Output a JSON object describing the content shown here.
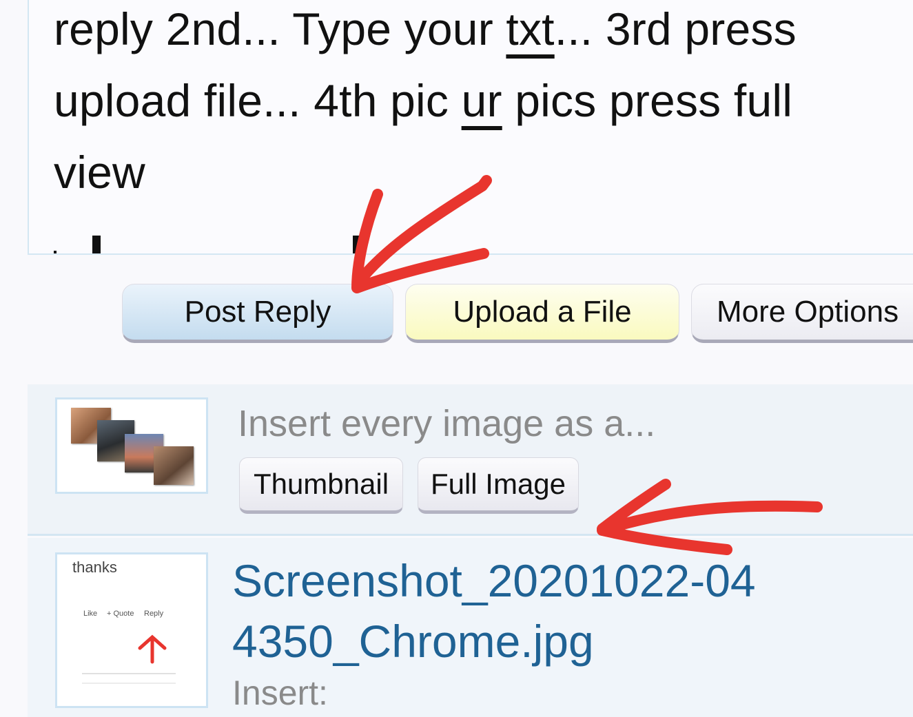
{
  "editor": {
    "line1_pre": "reply 2nd... Type your ",
    "line1_u": "txt",
    "line1_post": "... 3rd press",
    "line2_pre": "upload file... 4th pic ",
    "line2_u": "ur",
    "line2_post": " pics press full",
    "line3": "view"
  },
  "buttons": {
    "post_reply": "Post Reply",
    "upload_file": "Upload a File",
    "more_options": "More Options"
  },
  "insert_all": {
    "label": "Insert every image as a...",
    "thumbnail": "Thumbnail",
    "full_image": "Full Image"
  },
  "attachment": {
    "filename": "Screenshot_20201022-044350_Chrome.jpg",
    "insert_label": "Insert:",
    "preview_title": "thanks",
    "preview_like": "Like",
    "preview_quote": "+ Quote",
    "preview_reply": "Reply"
  },
  "colors": {
    "accent_link": "#1f6294",
    "annotation": "#e8352e"
  }
}
